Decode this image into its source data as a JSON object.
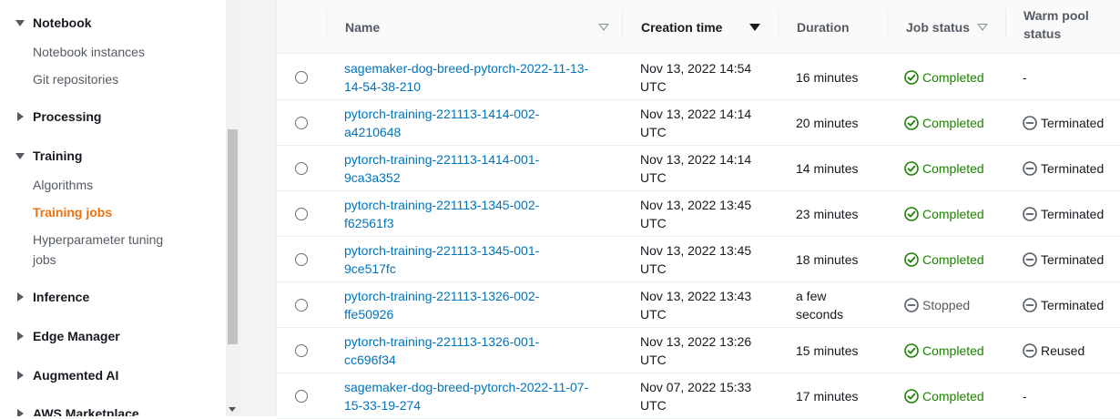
{
  "sidebar": {
    "notebook": {
      "label": "Notebook",
      "items": [
        "Notebook instances",
        "Git repositories"
      ]
    },
    "processing": {
      "label": "Processing"
    },
    "training": {
      "label": "Training",
      "items": [
        "Algorithms",
        "Training jobs",
        "Hyperparameter tuning",
        "jobs"
      ]
    },
    "inference": {
      "label": "Inference"
    },
    "edge_manager": {
      "label": "Edge Manager"
    },
    "augmented_ai": {
      "label": "Augmented AI"
    },
    "aws_marketplace": {
      "label": "AWS Marketplace"
    }
  },
  "table": {
    "headers": {
      "name": "Name",
      "creation_time": "Creation time",
      "duration": "Duration",
      "job_status": "Job status",
      "warm_pool_line1": "Warm pool",
      "warm_pool_line2": "status"
    },
    "rows": [
      {
        "name1": "sagemaker-dog-breed-pytorch-2022-11-13-",
        "name2": "14-54-38-210",
        "time1": "Nov 13, 2022 14:54",
        "time2": "UTC",
        "duration": "16 minutes",
        "duration2": "",
        "status": "Completed",
        "status_type": "completed",
        "warm": "-",
        "warm_icon": "none"
      },
      {
        "name1": "pytorch-training-221113-1414-002-",
        "name2": "a4210648",
        "time1": "Nov 13, 2022 14:14",
        "time2": "UTC",
        "duration": "20 minutes",
        "duration2": "",
        "status": "Completed",
        "status_type": "completed",
        "warm": "Terminated",
        "warm_icon": "stop"
      },
      {
        "name1": "pytorch-training-221113-1414-001-",
        "name2": "9ca3a352",
        "time1": "Nov 13, 2022 14:14",
        "time2": "UTC",
        "duration": "14 minutes",
        "duration2": "",
        "status": "Completed",
        "status_type": "completed",
        "warm": "Terminated",
        "warm_icon": "stop"
      },
      {
        "name1": "pytorch-training-221113-1345-002-",
        "name2": "f62561f3",
        "time1": "Nov 13, 2022 13:45",
        "time2": "UTC",
        "duration": "23 minutes",
        "duration2": "",
        "status": "Completed",
        "status_type": "completed",
        "warm": "Terminated",
        "warm_icon": "stop"
      },
      {
        "name1": "pytorch-training-221113-1345-001-",
        "name2": "9ce517fc",
        "time1": "Nov 13, 2022 13:45",
        "time2": "UTC",
        "duration": "18 minutes",
        "duration2": "",
        "status": "Completed",
        "status_type": "completed",
        "warm": "Terminated",
        "warm_icon": "stop"
      },
      {
        "name1": "pytorch-training-221113-1326-002-",
        "name2": "ffe50926",
        "time1": "Nov 13, 2022 13:43",
        "time2": "UTC",
        "duration": "a few",
        "duration2": "seconds",
        "status": "Stopped",
        "status_type": "stopped",
        "warm": "Terminated",
        "warm_icon": "stop"
      },
      {
        "name1": "pytorch-training-221113-1326-001-",
        "name2": "cc696f34",
        "time1": "Nov 13, 2022 13:26",
        "time2": "UTC",
        "duration": "15 minutes",
        "duration2": "",
        "status": "Completed",
        "status_type": "completed",
        "warm": "Reused",
        "warm_icon": "stop"
      },
      {
        "name1": "sagemaker-dog-breed-pytorch-2022-11-07-",
        "name2": "15-33-19-274",
        "time1": "Nov 07, 2022 15:33",
        "time2": "UTC",
        "duration": "17 minutes",
        "duration2": "",
        "status": "Completed",
        "status_type": "completed",
        "warm": "-",
        "warm_icon": "none"
      }
    ]
  },
  "colors": {
    "link": "#0073bb",
    "success": "#1d8102",
    "active_nav": "#ec7211"
  }
}
